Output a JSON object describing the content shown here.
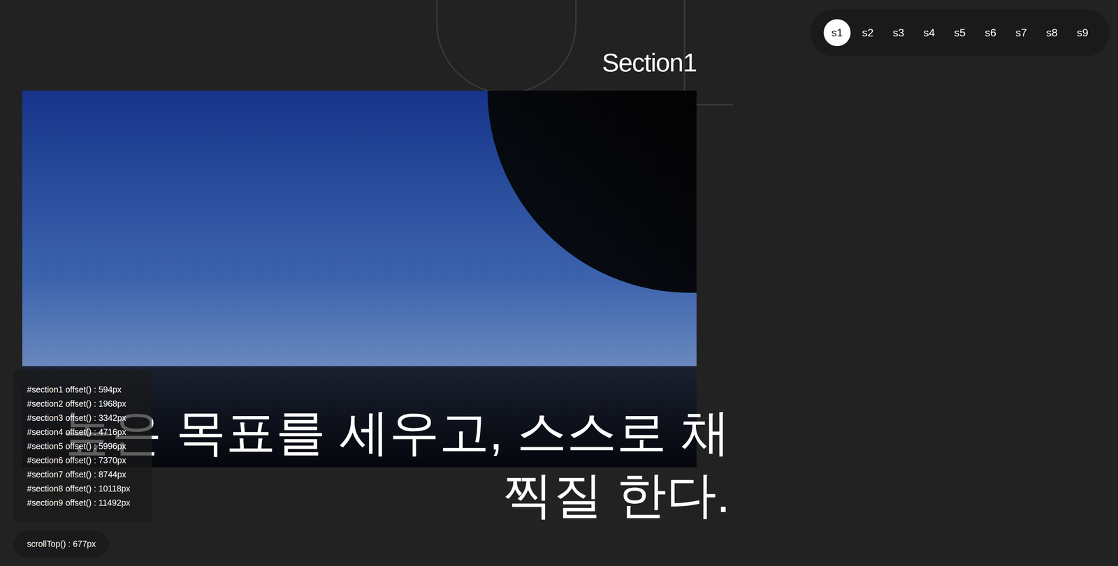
{
  "nav": [
    {
      "label": "s1",
      "selected": true
    },
    {
      "label": "s2",
      "selected": false
    },
    {
      "label": "s3",
      "selected": false
    },
    {
      "label": "s4",
      "selected": false
    },
    {
      "label": "s5",
      "selected": false
    },
    {
      "label": "s6",
      "selected": false
    },
    {
      "label": "s7",
      "selected": false
    },
    {
      "label": "s8",
      "selected": false
    },
    {
      "label": "s9",
      "selected": false
    }
  ],
  "section": {
    "title": "Section1",
    "heading": "높은 목표를 세우고, 스스로 채찍질 한다."
  },
  "offsets": [
    "#section1 offset() : 594px",
    "#section2 offset() : 1968px",
    "#section3 offset() : 3342px",
    "#section4 offset() : 4716px",
    "#section5 offset() : 5996px",
    "#section6 offset() : 7370px",
    "#section7 offset() : 8744px",
    "#section8 offset() : 10118px",
    "#section9 offset() : 11492px"
  ],
  "scroll": "scrollTop() : 677px"
}
